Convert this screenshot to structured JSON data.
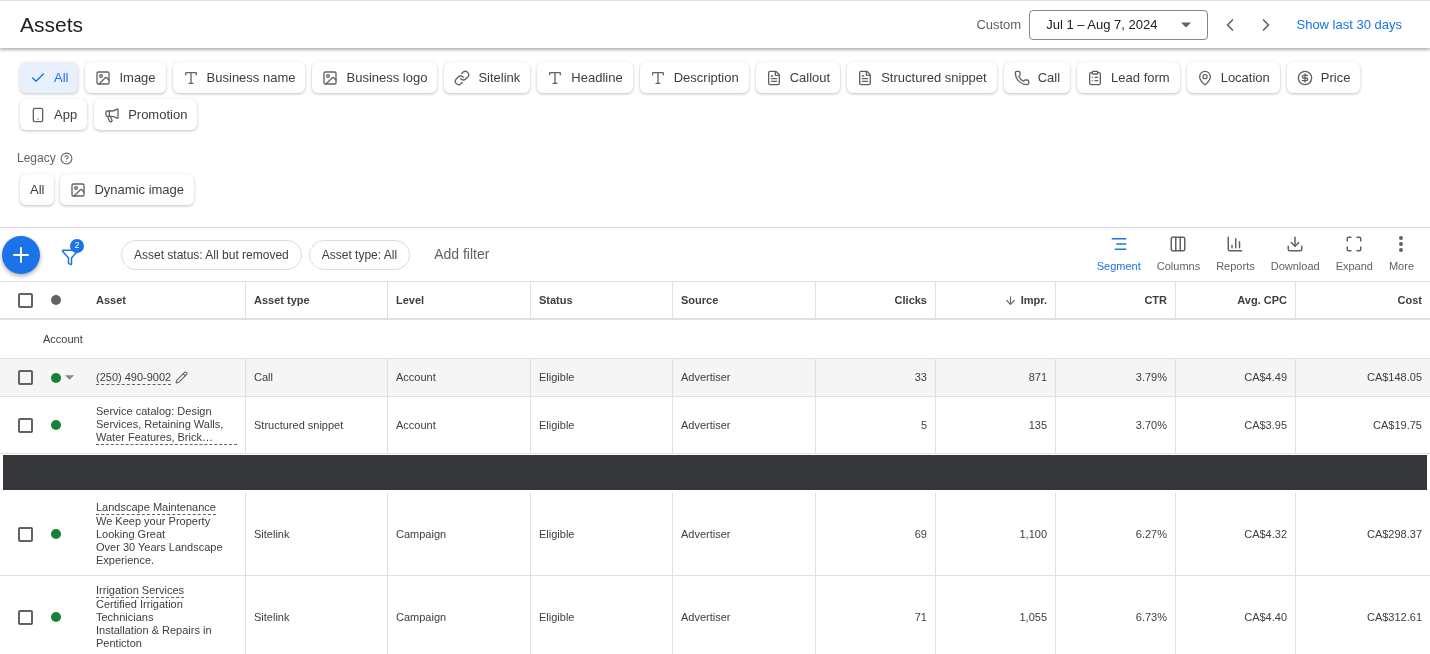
{
  "header": {
    "title": "Assets",
    "range_label": "Custom",
    "date_range": "Jul 1 – Aug 7, 2024",
    "quick_link": "Show last 30 days"
  },
  "upgraded_chips": [
    {
      "label": "All",
      "kind": "check",
      "selected": true
    },
    {
      "label": "Image",
      "kind": "image",
      "selected": false
    },
    {
      "label": "Business name",
      "kind": "text",
      "selected": false
    },
    {
      "label": "Business logo",
      "kind": "image",
      "selected": false
    },
    {
      "label": "Sitelink",
      "kind": "link",
      "selected": false
    },
    {
      "label": "Headline",
      "kind": "text",
      "selected": false
    },
    {
      "label": "Description",
      "kind": "text",
      "selected": false
    },
    {
      "label": "Callout",
      "kind": "doc",
      "selected": false
    },
    {
      "label": "Structured snippet",
      "kind": "doc",
      "selected": false
    },
    {
      "label": "Call",
      "kind": "phone",
      "selected": false
    },
    {
      "label": "Lead form",
      "kind": "form",
      "selected": false
    },
    {
      "label": "Location",
      "kind": "pin",
      "selected": false
    },
    {
      "label": "Price",
      "kind": "price",
      "selected": false
    },
    {
      "label": "App",
      "kind": "mobile",
      "selected": false
    },
    {
      "label": "Promotion",
      "kind": "megaphone",
      "selected": false
    }
  ],
  "legacy": {
    "label": "Legacy",
    "chips": [
      {
        "label": "All",
        "kind": "plain",
        "selected": false
      },
      {
        "label": "Dynamic image",
        "kind": "image",
        "selected": false
      }
    ]
  },
  "toolbar": {
    "filter_count": "2",
    "filters": [
      "Asset status: All but removed",
      "Asset type: All"
    ],
    "add_filter": "Add filter",
    "actions": [
      {
        "label": "Segment",
        "kind": "segment",
        "selected": true
      },
      {
        "label": "Columns",
        "kind": "columns",
        "selected": false
      },
      {
        "label": "Reports",
        "kind": "reports",
        "selected": false
      },
      {
        "label": "Download",
        "kind": "download",
        "selected": false
      },
      {
        "label": "Expand",
        "kind": "expand",
        "selected": false
      },
      {
        "label": "More",
        "kind": "more",
        "selected": false
      }
    ]
  },
  "table": {
    "select_all_checked": false,
    "columns": [
      {
        "label": "Asset",
        "sorted": false
      },
      {
        "label": "Asset type",
        "sorted": false
      },
      {
        "label": "Level",
        "sorted": false
      },
      {
        "label": "Status",
        "sorted": false
      },
      {
        "label": "Source",
        "sorted": false
      },
      {
        "label": "Clicks",
        "sorted": false
      },
      {
        "label": "Impr.",
        "sorted": true
      },
      {
        "label": "CTR",
        "sorted": false
      },
      {
        "label": "Avg. CPC",
        "sorted": false
      },
      {
        "label": "Cost",
        "sorted": false
      }
    ],
    "group": "Account",
    "rows": [
      {
        "kind": "row",
        "hovered": true,
        "checked": false,
        "color": "#188038",
        "title": "(250) 490-9002",
        "lines": [],
        "cells": [
          "Call",
          "Account",
          "Eligible",
          "Advertiser",
          "33",
          "871",
          "3.79%",
          "CA$4.49",
          "CA$148.05"
        ]
      },
      {
        "kind": "row",
        "hovered": false,
        "checked": false,
        "color": "#188038",
        "title": "Service catalog: Design Services, Retaining Walls, Water Features, Brick…",
        "lines": [],
        "cells": [
          "Structured snippet",
          "Account",
          "Eligible",
          "Advertiser",
          "5",
          "135",
          "3.70%",
          "CA$3.95",
          "CA$19.75"
        ]
      },
      {
        "kind": "redacted"
      },
      {
        "kind": "row",
        "hovered": false,
        "checked": false,
        "color": "#188038",
        "title": "Landscape Maintenance",
        "lines": [
          "We Keep your Property Looking Great",
          "Over 30 Years Landscape Experience."
        ],
        "cells": [
          "Sitelink",
          "Campaign",
          "Eligible",
          "Advertiser",
          "69",
          "1,100",
          "6.27%",
          "CA$4.32",
          "CA$298.37"
        ]
      },
      {
        "kind": "row",
        "hovered": false,
        "checked": false,
        "color": "#188038",
        "title": "Irrigation Services",
        "lines": [
          "Certified Irrigation Technicians",
          "Installation & Repairs in Penticton"
        ],
        "cells": [
          "Sitelink",
          "Campaign",
          "Eligible",
          "Advertiser",
          "71",
          "1,055",
          "6.73%",
          "CA$4.40",
          "CA$312.61"
        ]
      }
    ]
  }
}
